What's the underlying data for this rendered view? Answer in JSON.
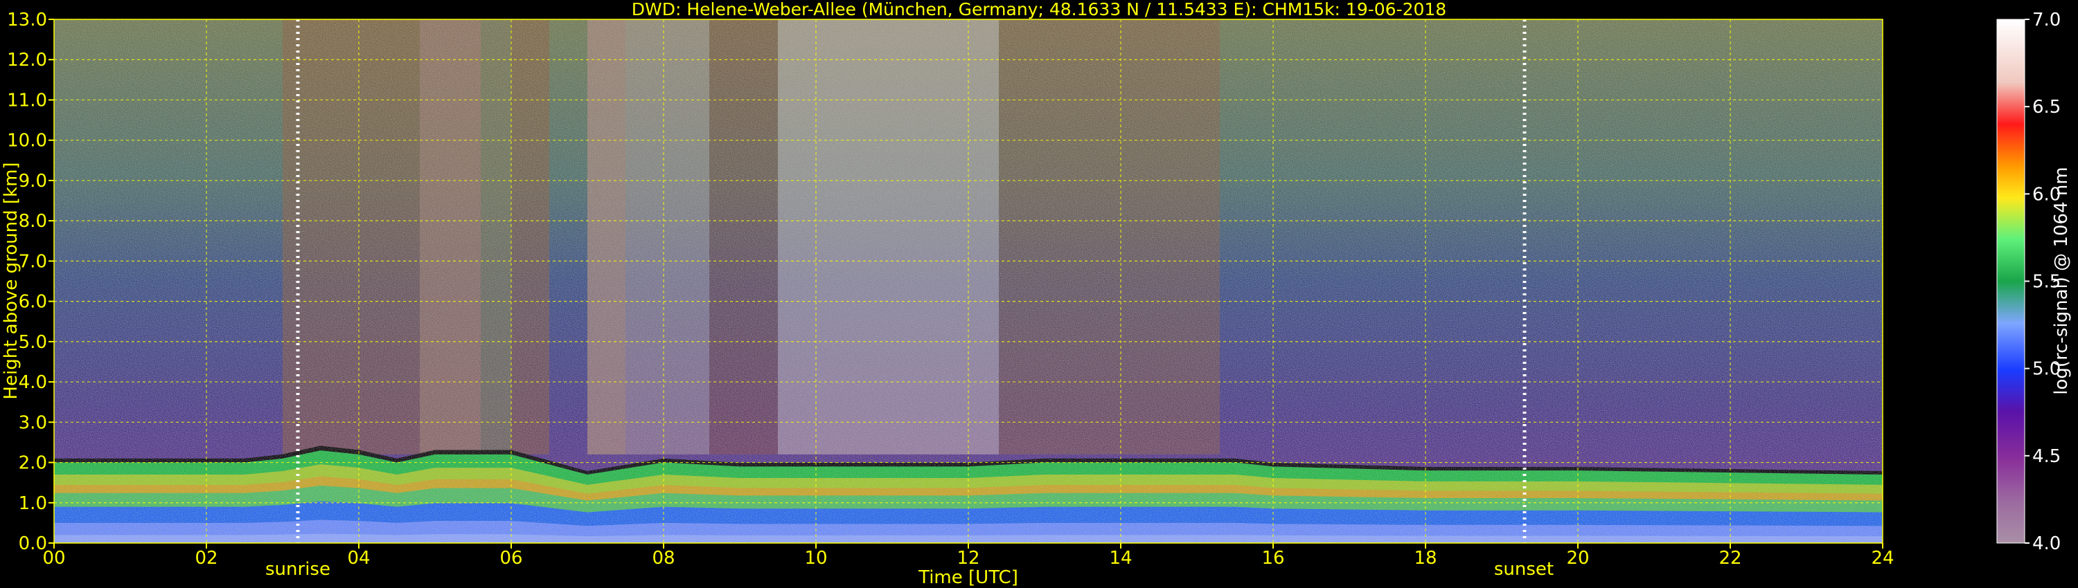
{
  "chart_data": {
    "type": "heatmap",
    "title": "DWD: Helene-Weber-Allee (München, Germany; 48.1633 N / 11.5433 E):    CHM15k: 19-06-2018",
    "xlabel": "Time [UTC]",
    "ylabel": "Height above ground [km]",
    "colorbar_label": "log(rc-signal) @ 1064 nm",
    "xlim": [
      0,
      24
    ],
    "ylim": [
      0,
      13
    ],
    "x_ticks": [
      "00",
      "02",
      "04",
      "06",
      "08",
      "10",
      "12",
      "14",
      "16",
      "18",
      "20",
      "22",
      "24"
    ],
    "y_ticks": [
      "0.0",
      "1.0",
      "2.0",
      "3.0",
      "4.0",
      "5.0",
      "6.0",
      "7.0",
      "8.0",
      "9.0",
      "10.0",
      "11.0",
      "12.0",
      "13.0"
    ],
    "colorbar_range": [
      4.0,
      7.0
    ],
    "colorbar_ticks": [
      "4.0",
      "4.5",
      "5.0",
      "5.5",
      "6.0",
      "6.5",
      "7.0"
    ],
    "grid": true,
    "annotations": [
      {
        "label": "sunrise",
        "x": 3.2
      },
      {
        "label": "sunset",
        "x": 19.3
      }
    ],
    "boundary_layer_top": [
      [
        0,
        2.0
      ],
      [
        2,
        2.0
      ],
      [
        2.5,
        2.0
      ],
      [
        3.0,
        2.1
      ],
      [
        3.5,
        2.3
      ],
      [
        4.0,
        2.2
      ],
      [
        4.5,
        2.0
      ],
      [
        5.0,
        2.2
      ],
      [
        6.0,
        2.2
      ],
      [
        7.0,
        1.7
      ],
      [
        8.0,
        2.0
      ],
      [
        9.0,
        1.9
      ],
      [
        10.0,
        1.9
      ],
      [
        11.0,
        1.9
      ],
      [
        12.0,
        1.9
      ],
      [
        13.0,
        2.0
      ],
      [
        14.0,
        2.0
      ],
      [
        15.0,
        2.0
      ],
      [
        15.5,
        2.0
      ],
      [
        16.0,
        1.9
      ],
      [
        18.0,
        1.8
      ],
      [
        20.0,
        1.8
      ],
      [
        24.0,
        1.7
      ]
    ],
    "colors": {
      "axis": "#FFFF00",
      "grid": "#FFFF00",
      "markers": "#FFFFFF",
      "background": "#000000"
    }
  }
}
